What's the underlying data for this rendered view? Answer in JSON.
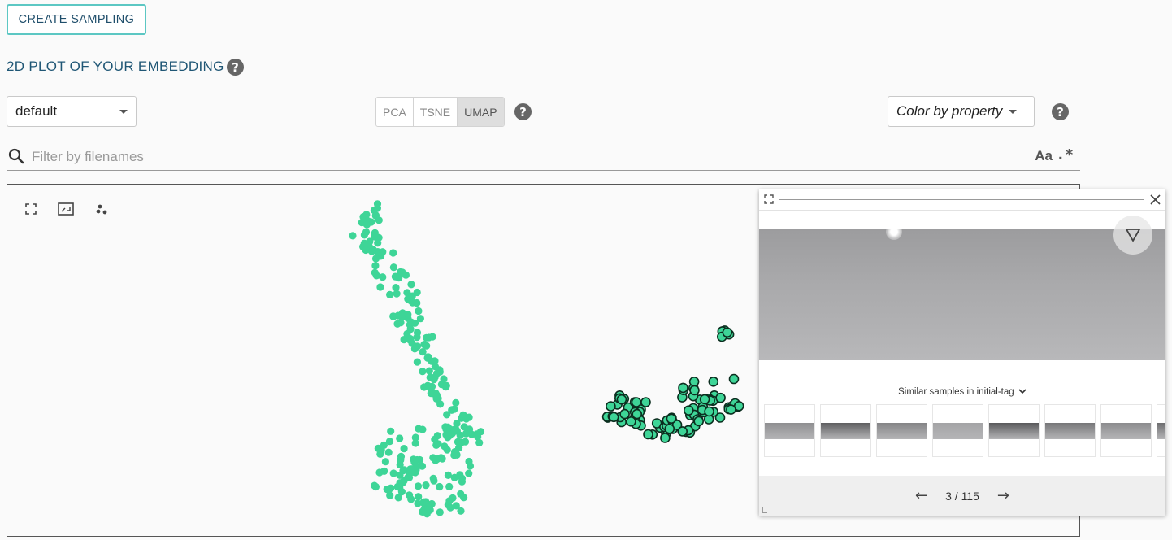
{
  "create_button": "CREATE SAMPLING",
  "section_title": "2D PLOT OF YOUR EMBEDDING",
  "help_glyph": "?",
  "embedding_select": {
    "value": "default"
  },
  "projection": {
    "options": [
      "PCA",
      "TSNE",
      "UMAP"
    ],
    "selected": "UMAP"
  },
  "color_select": {
    "value": "Color by property"
  },
  "filter": {
    "placeholder": "Filter by filenames",
    "case_toggle": "Aa",
    "regex_toggle": ".*"
  },
  "plot": {
    "point_color": "#3ed597",
    "selected_outline": "#0b2e1f",
    "tools": [
      "fullscreen-icon",
      "fit-view-icon",
      "scatter-icon"
    ]
  },
  "preview": {
    "similar_label": "Similar samples in initial-tag",
    "page": "3 / 115",
    "prev_glyph": "←",
    "next_glyph": "→",
    "thumbnails": [
      {
        "tone": "#8f8f91"
      },
      {
        "tone": "#5f5f61"
      },
      {
        "tone": "#858587"
      },
      {
        "tone": "#a4a4a6"
      },
      {
        "tone": "#5a5a5c"
      },
      {
        "tone": "#777779"
      },
      {
        "tone": "#8c8c8e"
      },
      {
        "tone": "#6e6e70"
      }
    ]
  }
}
